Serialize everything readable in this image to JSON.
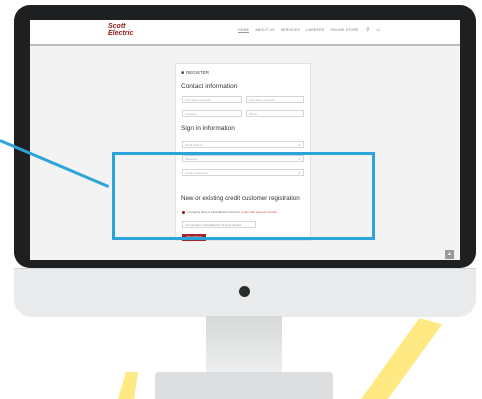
{
  "colors": {
    "accent": "#2aa4d9",
    "brand": "#8b1a1a",
    "button": "#a4262c"
  },
  "site": {
    "logo_line1": "Scott",
    "logo_line2": "Electric",
    "nav": [
      "HOME",
      "ABOUT US",
      "SERVICES",
      "CAREERS",
      "ONLINE STORE"
    ],
    "icons": [
      "search-icon",
      "user-icon"
    ]
  },
  "form": {
    "register_label": "REGISTER",
    "contact_heading": "Contact information",
    "first_name_placeholder": "First name (required)",
    "last_name_placeholder": "Last name (required)",
    "company_placeholder": "Company",
    "phone_placeholder": "Phone",
    "signin_heading": "Sign in information",
    "email_placeholder": "Email address",
    "password_placeholder": "Password",
    "confirm_password_placeholder": "Confirm password",
    "customer_heading": "New or existing credit customer registration",
    "radio_text": "I currently have a Scott Electric account.",
    "radio_link": "Login with account number",
    "account_select": "I do not have a Scott Electric account number",
    "submit_label": "REGISTER"
  }
}
